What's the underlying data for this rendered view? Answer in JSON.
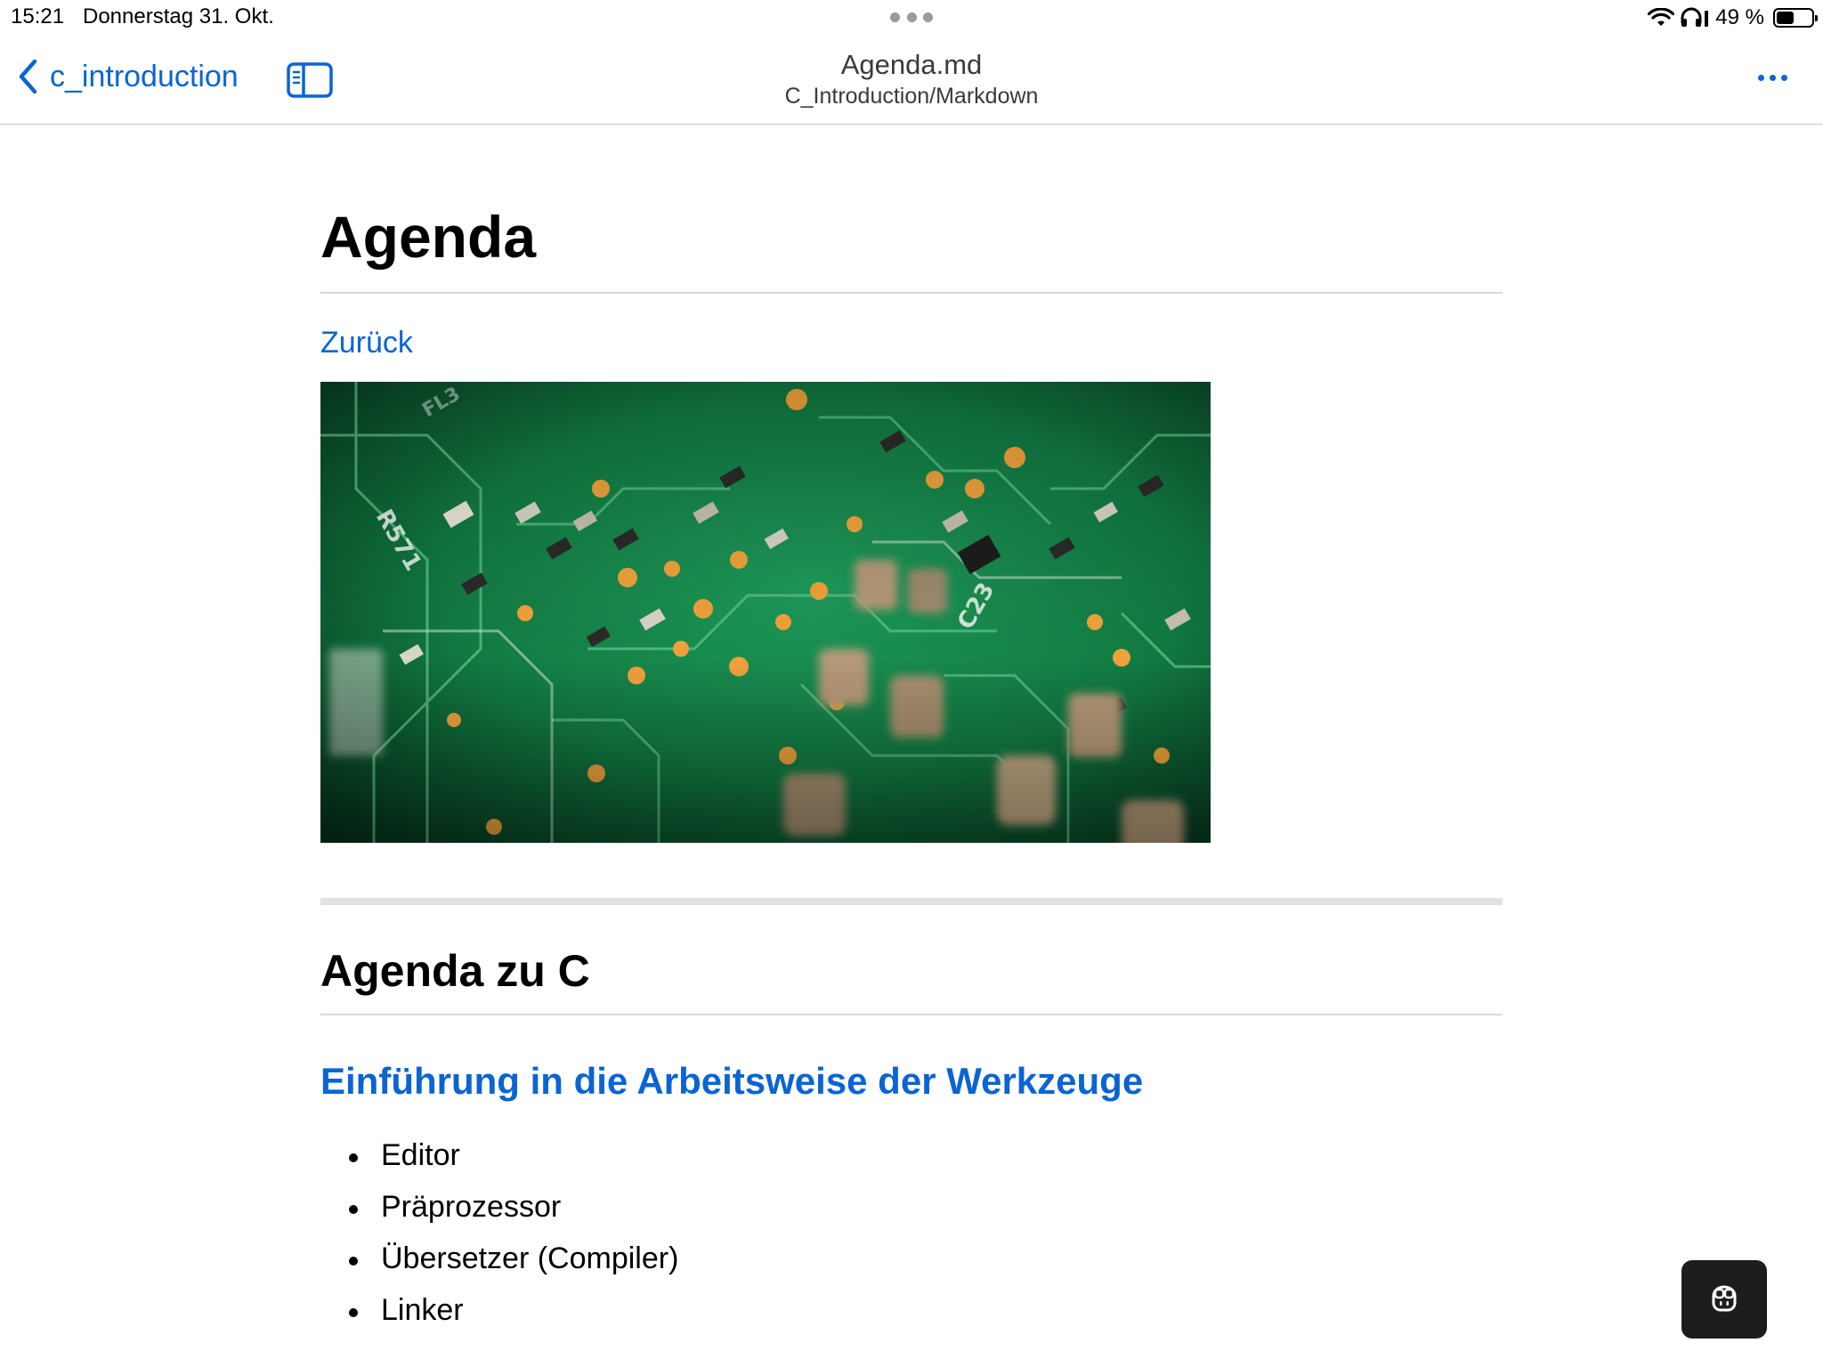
{
  "status_bar": {
    "time": "15:21",
    "date": "Donnerstag 31. Okt.",
    "battery_text": "49 %",
    "battery_level": 0.49,
    "icons": [
      "multitasking-dots-icon",
      "wifi-icon",
      "headphones-icon",
      "battery-icon"
    ]
  },
  "navbar": {
    "back_label": "c_introduction",
    "title": "Agenda.md",
    "subtitle": "C_Introduction/Markdown",
    "accent_color": "#0a64d4",
    "icons": [
      "chevron-left-icon",
      "sidebar-toggle-icon",
      "ellipsis-icon"
    ]
  },
  "document": {
    "heading": "Agenda",
    "back_link": "Zurück",
    "image_alt": "circuit board photo",
    "section_heading": "Agenda zu C",
    "subsection_link": "Einführung in die Arbeitsweise der Werkzeuge",
    "list_items": [
      "Editor",
      "Präprozessor",
      "Übersetzer (Compiler)",
      "Linker"
    ]
  },
  "fab": {
    "icon": "copilot-icon"
  }
}
